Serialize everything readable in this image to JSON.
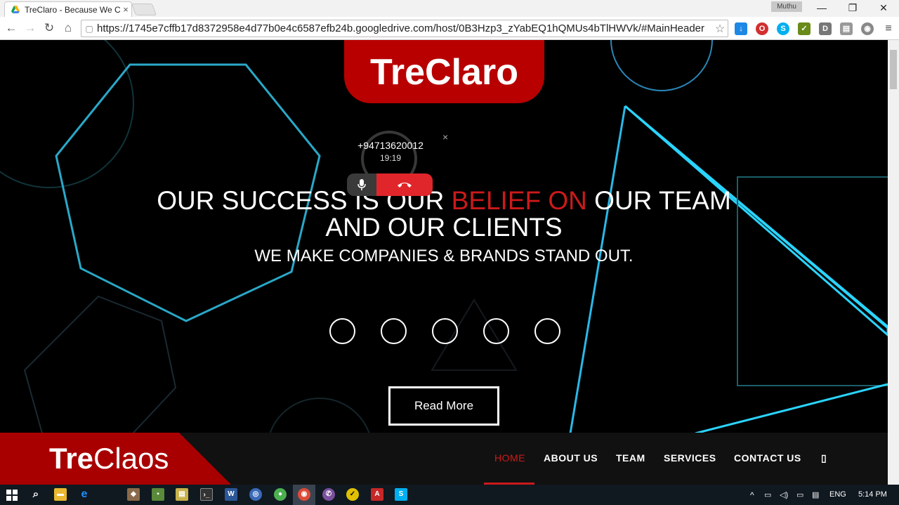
{
  "browser": {
    "tab_title": "TreClaro - Because We Car",
    "tab_close": "×",
    "profile_name": "Muthu",
    "url": "https://1745e7cffb17d8372958e4d77b0e4c6587efb24b.googledrive.com/host/0B3Hzp3_zYabEQ1hQMUs4bTlHWVk/#MainHeader",
    "window_controls": {
      "minimize": "—",
      "restore": "❐",
      "close": "✕"
    },
    "nav": {
      "back": "←",
      "forward": "→",
      "reload": "↻",
      "home": "⌂"
    },
    "extensions": [
      "download-icon",
      "opera-icon",
      "skype-icon",
      "checkmark-icon",
      "d-icon",
      "pages-icon",
      "circle-icon",
      "menu-icon"
    ]
  },
  "hero": {
    "logo_text": "TreClaro",
    "headline_before": "OUR SUCCESS IS OUR ",
    "headline_accent": "BELIEF ON",
    "headline_after": " OUR TEAM",
    "headline_line2": "AND OUR CLIENTS",
    "subline": "WE MAKE COMPANIES & BRANDS STAND OUT.",
    "read_more": "Read More",
    "slide_count": 5,
    "accent_color": "#cc1a1a"
  },
  "call_widget": {
    "number": "+94713620012",
    "duration": "19:19",
    "close": "×"
  },
  "navbar": {
    "logo_text_bold": "Tre",
    "logo_text_rest": "Claos",
    "items": [
      {
        "label": "HOME",
        "active": true
      },
      {
        "label": "ABOUT US",
        "active": false
      },
      {
        "label": "TEAM",
        "active": false
      },
      {
        "label": "SERVICES",
        "active": false
      },
      {
        "label": "CONTACT US",
        "active": false
      }
    ],
    "search_glyph": "▯"
  },
  "taskbar": {
    "language": "ENG",
    "time": "5:14 PM"
  }
}
